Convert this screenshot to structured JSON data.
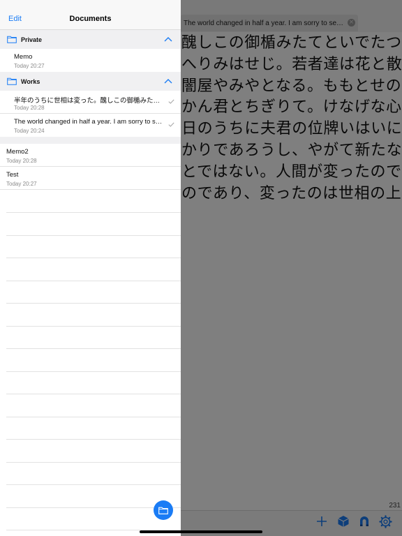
{
  "editor": {
    "tab_title": "The world changed in half a year. I am sorry to see y...",
    "lines": [
      "醜しこの御楯みたてといでたつ我",
      "へりみはせじ。若者達は花と散っ",
      "闇屋やみやとなる。ももとせの命",
      "かん君とちぎりて。けなげな心情",
      "日のうちに夫君の位牌いはいにぬ",
      "かりであろうし、やがて新たな面",
      "とではない。人間が変ったのでは",
      "のであり、変ったのは世相の上皮"
    ],
    "char_count": "231",
    "toolbar": {
      "icons": [
        "plus-icon",
        "cube-icon",
        "magnet-icon",
        "gear-icon"
      ]
    }
  },
  "panel": {
    "edit_label": "Edit",
    "title": "Documents",
    "groups": [
      {
        "name": "Private",
        "items": [
          {
            "name": "Memo",
            "date": "Today 20:27"
          }
        ]
      },
      {
        "name": "Works",
        "items": [
          {
            "name": "半年のうちに世相は変った。醜しこの御楯みたてといでた...",
            "date": "Today 20:28"
          },
          {
            "name": "The world changed in half a year. I am sorry to see y...",
            "date": "Today 20:24"
          }
        ]
      }
    ],
    "ungrouped": [
      {
        "name": "Memo2",
        "date": "Today 20:28"
      },
      {
        "name": "Test",
        "date": "Today 20:27"
      }
    ]
  },
  "colors": {
    "accent": "#1a7cf5",
    "dim_overlay": "rgba(0,0,0,0.5)",
    "group_header_bg": "#f0f0f2"
  }
}
